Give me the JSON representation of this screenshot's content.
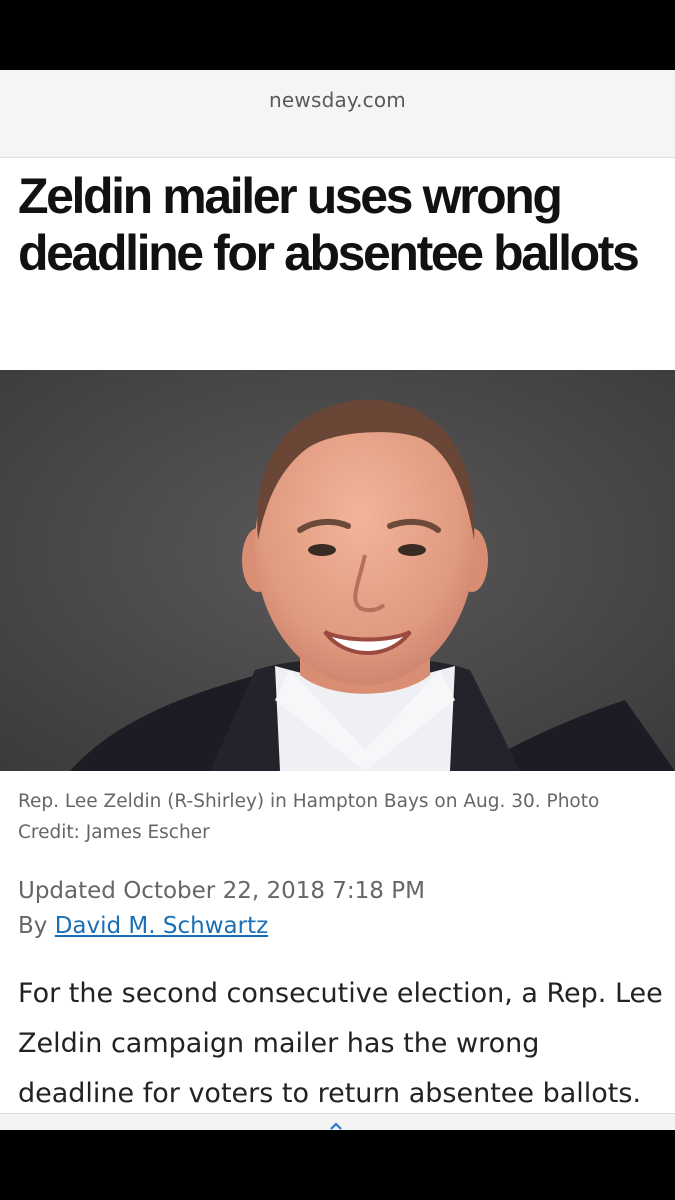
{
  "browser": {
    "url": "newsday.com",
    "page_indicator": {
      "count": 3,
      "active": 1
    },
    "icons": [
      "link-icon",
      "overflow-menu-icon"
    ]
  },
  "article": {
    "headline": "Zeldin mailer uses wrong deadline for absentee ballots",
    "photo_caption": "Rep. Lee Zeldin (R-Shirley) in Hampton Bays on Aug. 30. Photo Credit: James Escher",
    "updated": "Updated October 22, 2018 7:18 PM",
    "byline_prefix": "By ",
    "author": "David M. Schwartz",
    "body": "For the second consecutive election, a Rep. Lee Zeldin campaign mailer has the wrong deadline for voters to return absentee ballots."
  },
  "colors": {
    "link": "#1a6fb5",
    "headline": "#111111",
    "meta_text": "#666666",
    "url_bar_bg": "#f5f5f5"
  }
}
